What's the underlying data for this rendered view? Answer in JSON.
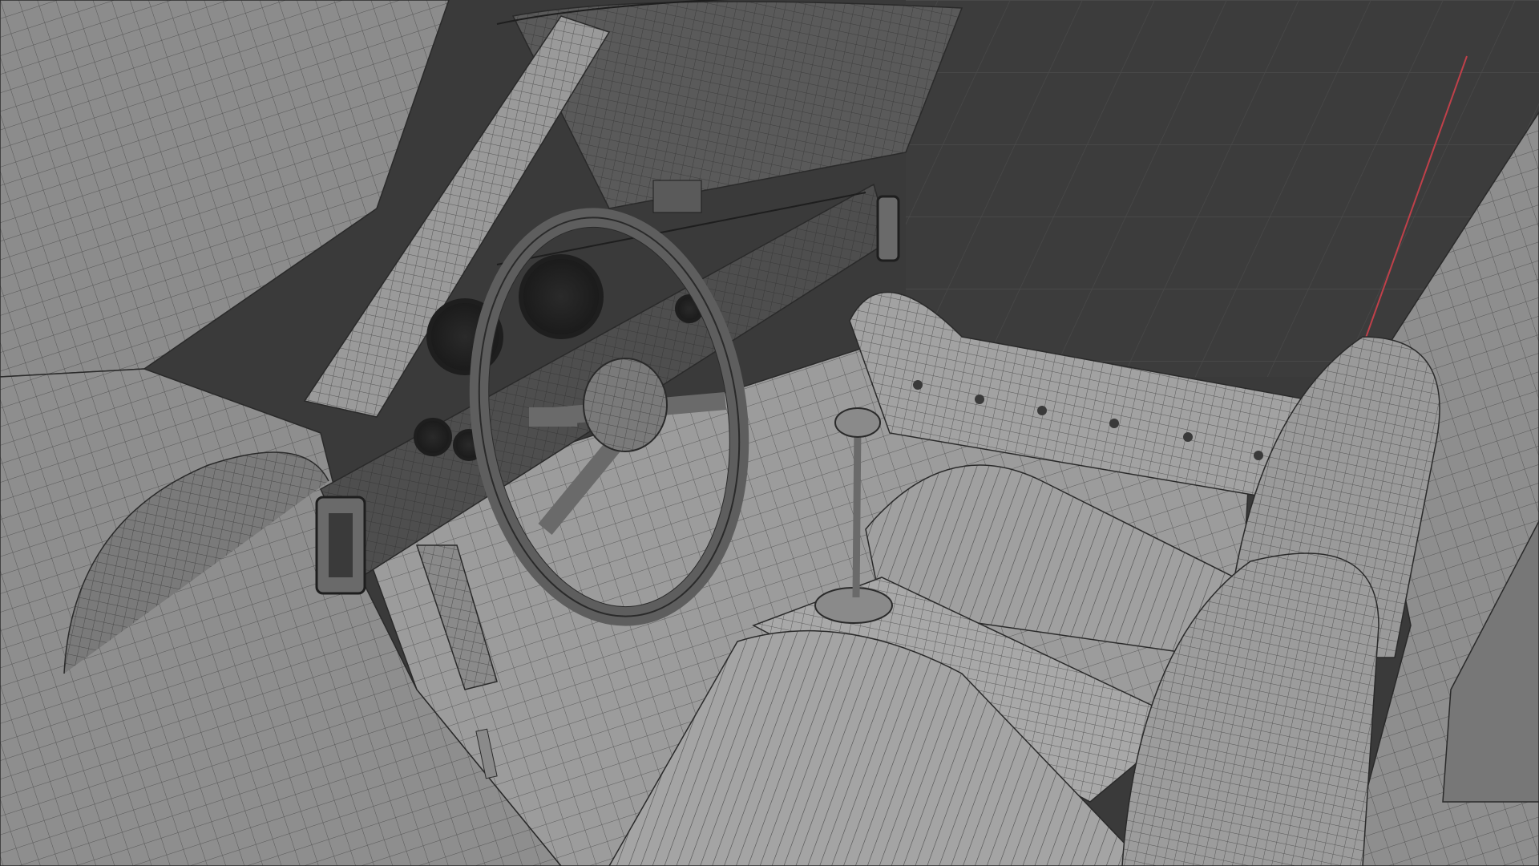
{
  "viewport": {
    "background_color": "#3a3a3a",
    "ground_grid_color": "#3c3c3c",
    "grid_line_color": "#4a4a4a",
    "axis_x_color": "#c0404a",
    "model_surface_color": "#8e8e8e",
    "model_light_color": "#a2a2a2",
    "model_dark_color": "#5a5a5a",
    "wire_color": "#2a2a2a"
  },
  "scene": {
    "display_mode": "wireframe-on-shaded",
    "objects": [
      "windscreen-frame",
      "open-gullwing-door",
      "dashboard",
      "steering-wheel",
      "instrument-gauges",
      "gear-lever",
      "driver-seat",
      "passenger-seat",
      "door-sill",
      "floor-pedal"
    ]
  }
}
